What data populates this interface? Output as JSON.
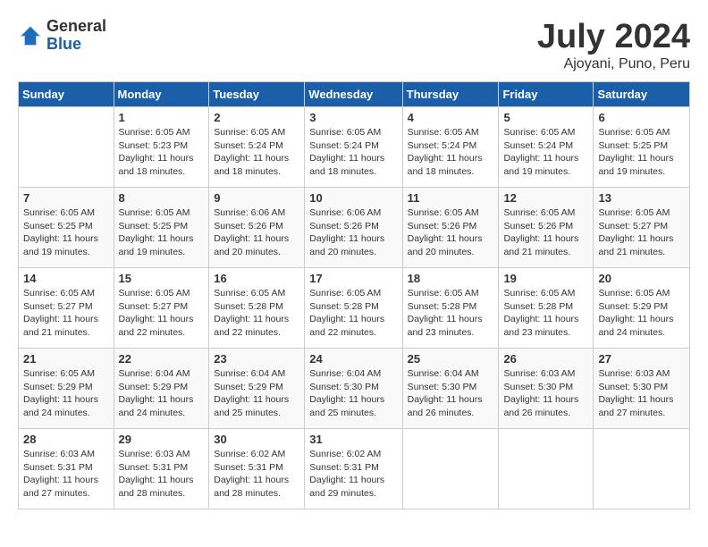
{
  "header": {
    "logo": {
      "general": "General",
      "blue": "Blue"
    },
    "title": "July 2024",
    "location": "Ajoyani, Puno, Peru"
  },
  "weekdays": [
    "Sunday",
    "Monday",
    "Tuesday",
    "Wednesday",
    "Thursday",
    "Friday",
    "Saturday"
  ],
  "weeks": [
    [
      {
        "day": null
      },
      {
        "day": "1",
        "sunrise": "Sunrise: 6:05 AM",
        "sunset": "Sunset: 5:23 PM",
        "daylight": "Daylight: 11 hours and 18 minutes."
      },
      {
        "day": "2",
        "sunrise": "Sunrise: 6:05 AM",
        "sunset": "Sunset: 5:24 PM",
        "daylight": "Daylight: 11 hours and 18 minutes."
      },
      {
        "day": "3",
        "sunrise": "Sunrise: 6:05 AM",
        "sunset": "Sunset: 5:24 PM",
        "daylight": "Daylight: 11 hours and 18 minutes."
      },
      {
        "day": "4",
        "sunrise": "Sunrise: 6:05 AM",
        "sunset": "Sunset: 5:24 PM",
        "daylight": "Daylight: 11 hours and 18 minutes."
      },
      {
        "day": "5",
        "sunrise": "Sunrise: 6:05 AM",
        "sunset": "Sunset: 5:24 PM",
        "daylight": "Daylight: 11 hours and 19 minutes."
      },
      {
        "day": "6",
        "sunrise": "Sunrise: 6:05 AM",
        "sunset": "Sunset: 5:25 PM",
        "daylight": "Daylight: 11 hours and 19 minutes."
      }
    ],
    [
      {
        "day": "7",
        "sunrise": "Sunrise: 6:05 AM",
        "sunset": "Sunset: 5:25 PM",
        "daylight": "Daylight: 11 hours and 19 minutes."
      },
      {
        "day": "8",
        "sunrise": "Sunrise: 6:05 AM",
        "sunset": "Sunset: 5:25 PM",
        "daylight": "Daylight: 11 hours and 19 minutes."
      },
      {
        "day": "9",
        "sunrise": "Sunrise: 6:06 AM",
        "sunset": "Sunset: 5:26 PM",
        "daylight": "Daylight: 11 hours and 20 minutes."
      },
      {
        "day": "10",
        "sunrise": "Sunrise: 6:06 AM",
        "sunset": "Sunset: 5:26 PM",
        "daylight": "Daylight: 11 hours and 20 minutes."
      },
      {
        "day": "11",
        "sunrise": "Sunrise: 6:05 AM",
        "sunset": "Sunset: 5:26 PM",
        "daylight": "Daylight: 11 hours and 20 minutes."
      },
      {
        "day": "12",
        "sunrise": "Sunrise: 6:05 AM",
        "sunset": "Sunset: 5:26 PM",
        "daylight": "Daylight: 11 hours and 21 minutes."
      },
      {
        "day": "13",
        "sunrise": "Sunrise: 6:05 AM",
        "sunset": "Sunset: 5:27 PM",
        "daylight": "Daylight: 11 hours and 21 minutes."
      }
    ],
    [
      {
        "day": "14",
        "sunrise": "Sunrise: 6:05 AM",
        "sunset": "Sunset: 5:27 PM",
        "daylight": "Daylight: 11 hours and 21 minutes."
      },
      {
        "day": "15",
        "sunrise": "Sunrise: 6:05 AM",
        "sunset": "Sunset: 5:27 PM",
        "daylight": "Daylight: 11 hours and 22 minutes."
      },
      {
        "day": "16",
        "sunrise": "Sunrise: 6:05 AM",
        "sunset": "Sunset: 5:28 PM",
        "daylight": "Daylight: 11 hours and 22 minutes."
      },
      {
        "day": "17",
        "sunrise": "Sunrise: 6:05 AM",
        "sunset": "Sunset: 5:28 PM",
        "daylight": "Daylight: 11 hours and 22 minutes."
      },
      {
        "day": "18",
        "sunrise": "Sunrise: 6:05 AM",
        "sunset": "Sunset: 5:28 PM",
        "daylight": "Daylight: 11 hours and 23 minutes."
      },
      {
        "day": "19",
        "sunrise": "Sunrise: 6:05 AM",
        "sunset": "Sunset: 5:28 PM",
        "daylight": "Daylight: 11 hours and 23 minutes."
      },
      {
        "day": "20",
        "sunrise": "Sunrise: 6:05 AM",
        "sunset": "Sunset: 5:29 PM",
        "daylight": "Daylight: 11 hours and 24 minutes."
      }
    ],
    [
      {
        "day": "21",
        "sunrise": "Sunrise: 6:05 AM",
        "sunset": "Sunset: 5:29 PM",
        "daylight": "Daylight: 11 hours and 24 minutes."
      },
      {
        "day": "22",
        "sunrise": "Sunrise: 6:04 AM",
        "sunset": "Sunset: 5:29 PM",
        "daylight": "Daylight: 11 hours and 24 minutes."
      },
      {
        "day": "23",
        "sunrise": "Sunrise: 6:04 AM",
        "sunset": "Sunset: 5:29 PM",
        "daylight": "Daylight: 11 hours and 25 minutes."
      },
      {
        "day": "24",
        "sunrise": "Sunrise: 6:04 AM",
        "sunset": "Sunset: 5:30 PM",
        "daylight": "Daylight: 11 hours and 25 minutes."
      },
      {
        "day": "25",
        "sunrise": "Sunrise: 6:04 AM",
        "sunset": "Sunset: 5:30 PM",
        "daylight": "Daylight: 11 hours and 26 minutes."
      },
      {
        "day": "26",
        "sunrise": "Sunrise: 6:03 AM",
        "sunset": "Sunset: 5:30 PM",
        "daylight": "Daylight: 11 hours and 26 minutes."
      },
      {
        "day": "27",
        "sunrise": "Sunrise: 6:03 AM",
        "sunset": "Sunset: 5:30 PM",
        "daylight": "Daylight: 11 hours and 27 minutes."
      }
    ],
    [
      {
        "day": "28",
        "sunrise": "Sunrise: 6:03 AM",
        "sunset": "Sunset: 5:31 PM",
        "daylight": "Daylight: 11 hours and 27 minutes."
      },
      {
        "day": "29",
        "sunrise": "Sunrise: 6:03 AM",
        "sunset": "Sunset: 5:31 PM",
        "daylight": "Daylight: 11 hours and 28 minutes."
      },
      {
        "day": "30",
        "sunrise": "Sunrise: 6:02 AM",
        "sunset": "Sunset: 5:31 PM",
        "daylight": "Daylight: 11 hours and 28 minutes."
      },
      {
        "day": "31",
        "sunrise": "Sunrise: 6:02 AM",
        "sunset": "Sunset: 5:31 PM",
        "daylight": "Daylight: 11 hours and 29 minutes."
      },
      {
        "day": null
      },
      {
        "day": null
      },
      {
        "day": null
      }
    ]
  ]
}
